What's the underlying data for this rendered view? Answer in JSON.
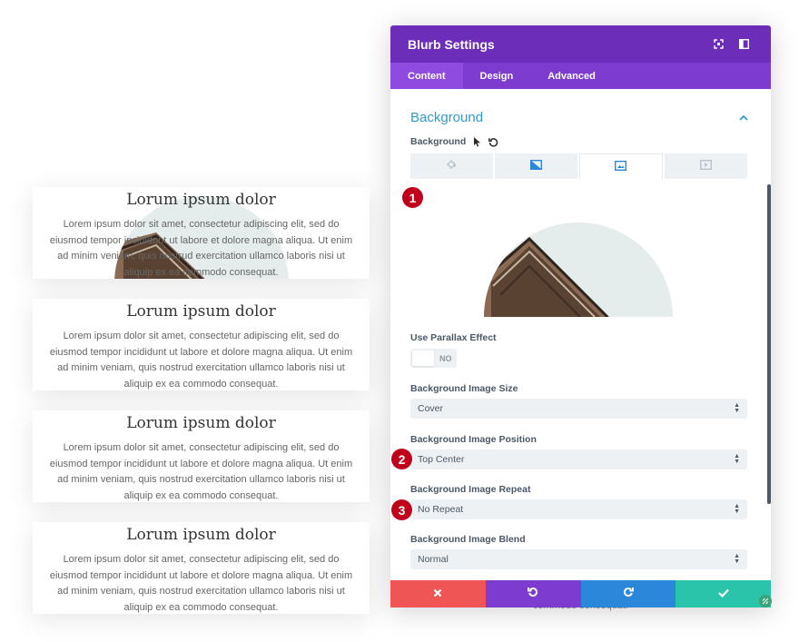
{
  "cards": [
    {
      "title": "Lorum ipsum dolor",
      "text": "Lorem ipsum dolor sit amet, consectetur adipiscing elit, sed do eiusmod tempor incididunt ut labore et dolore magna aliqua. Ut enim ad minim veniam, quis nostrud exercitation ullamco laboris nisi ut aliquip ex ea commodo consequat."
    },
    {
      "title": "Lorum ipsum dolor",
      "text": "Lorem ipsum dolor sit amet, consectetur adipiscing elit, sed do eiusmod tempor incididunt ut labore et dolore magna aliqua. Ut enim ad minim veniam, quis nostrud exercitation ullamco laboris nisi ut aliquip ex ea commodo consequat."
    },
    {
      "title": "Lorum ipsum dolor",
      "text": "Lorem ipsum dolor sit amet, consectetur adipiscing elit, sed do eiusmod tempor incididunt ut labore et dolore magna aliqua. Ut enim ad minim veniam, quis nostrud exercitation ullamco laboris nisi ut aliquip ex ea commodo consequat."
    },
    {
      "title": "Lorum ipsum dolor",
      "text": "Lorem ipsum dolor sit amet, consectetur adipiscing elit, sed do eiusmod tempor incididunt ut labore et dolore magna aliqua. Ut enim ad minim veniam, quis nostrud exercitation ullamco laboris nisi ut aliquip ex ea commodo consequat."
    }
  ],
  "panel": {
    "title": "Blurb Settings",
    "tabs": [
      "Content",
      "Design",
      "Advanced"
    ],
    "active_tab": "Content",
    "section_title": "Background",
    "background_label": "Background",
    "background_tabs": [
      "color-icon",
      "gradient-icon",
      "image-icon",
      "video-icon"
    ],
    "active_background_tab": "image-icon",
    "parallax": {
      "label": "Use Parallax Effect",
      "value": "NO"
    },
    "image_size": {
      "label": "Background Image Size",
      "value": "Cover"
    },
    "image_position": {
      "label": "Background Image Position",
      "value": "Top Center"
    },
    "image_repeat": {
      "label": "Background Image Repeat",
      "value": "No Repeat"
    },
    "image_blend": {
      "label": "Background Image Blend",
      "value": "Normal"
    },
    "behind_text": "commodo consequat."
  },
  "badges": [
    "1",
    "2",
    "3"
  ],
  "colors": {
    "header": "#6c2eb9",
    "tabs_bar": "#7d3bcf",
    "section_title": "#2e9bd1",
    "cancel": "#ef5555",
    "undo": "#7e3bd0",
    "redo": "#2b87da",
    "save": "#29c4a9",
    "badge": "#c0001a"
  }
}
